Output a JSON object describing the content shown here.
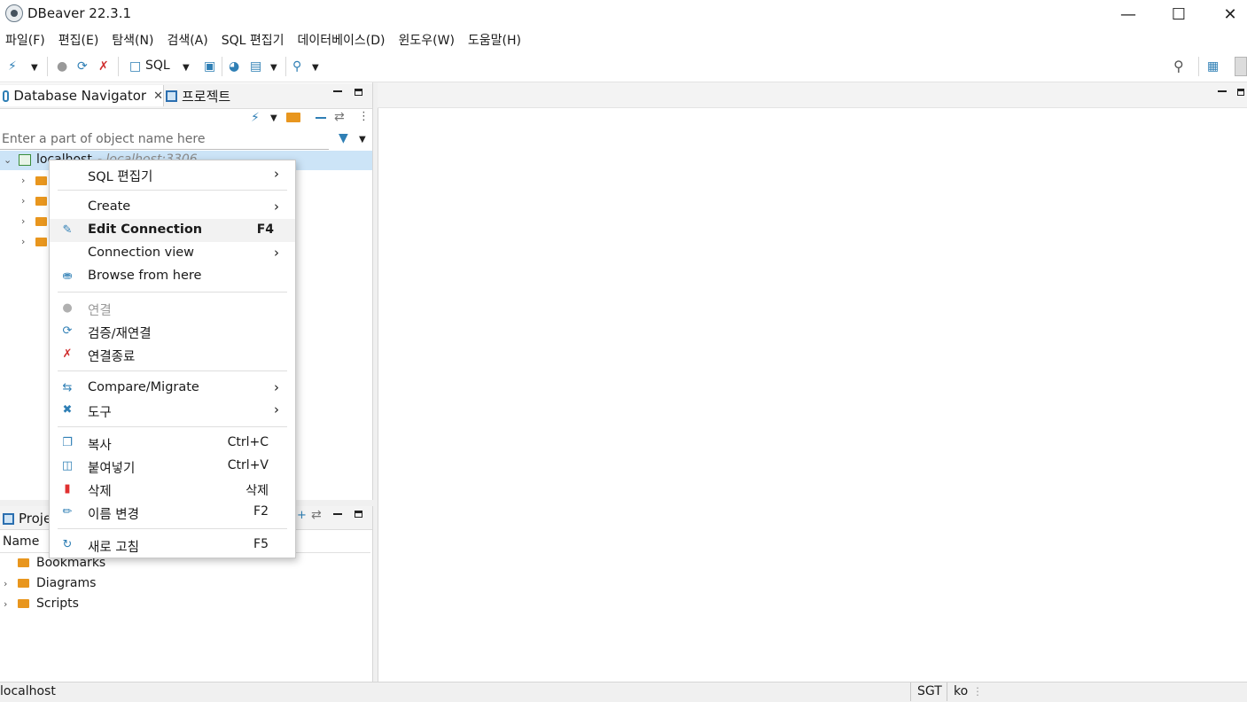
{
  "window": {
    "title": "DBeaver 22.3.1"
  },
  "menubar": [
    "파일(F)",
    "편집(E)",
    "탐색(N)",
    "검색(A)",
    "SQL 편집기",
    "데이터베이스(D)",
    "윈도우(W)",
    "도움말(H)"
  ],
  "toolbar": {
    "sql_label": "SQL"
  },
  "navigator": {
    "tab_label": "Database Navigator",
    "projects_tab_label": "프로젝트",
    "filter_placeholder": "Enter a part of object name here",
    "connection_name": "localhost",
    "connection_detail": "- localhost:3306"
  },
  "context_menu": {
    "items": [
      {
        "label": "SQL 편집기",
        "shortcut": "",
        "icon": "none",
        "submenu": true
      },
      {
        "label": "Create",
        "shortcut": "",
        "icon": "none",
        "submenu": true
      },
      {
        "label": "Edit Connection",
        "shortcut": "F4",
        "icon": "pencil-icon",
        "bold": true
      },
      {
        "label": "Connection view",
        "shortcut": "",
        "icon": "none",
        "submenu": true
      },
      {
        "label": "Browse from here",
        "shortcut": "",
        "icon": "database-icon"
      },
      {
        "label": "연결",
        "shortcut": "",
        "icon": "plug-icon",
        "disabled": true
      },
      {
        "label": "검증/재연결",
        "shortcut": "",
        "icon": "reconnect-icon"
      },
      {
        "label": "연결종료",
        "shortcut": "",
        "icon": "disconnect-icon"
      },
      {
        "label": "Compare/Migrate",
        "shortcut": "",
        "icon": "compare-icon",
        "submenu": true
      },
      {
        "label": "도구",
        "shortcut": "",
        "icon": "tools-icon",
        "submenu": true
      },
      {
        "label": "복사",
        "shortcut": "Ctrl+C",
        "icon": "copy-icon"
      },
      {
        "label": "붙여넣기",
        "shortcut": "Ctrl+V",
        "icon": "paste-icon"
      },
      {
        "label": "삭제",
        "shortcut": "삭제",
        "icon": "delete-icon"
      },
      {
        "label": "이름 변경",
        "shortcut": "F2",
        "icon": "rename-icon"
      },
      {
        "label": "새로 고침",
        "shortcut": "F5",
        "icon": "refresh-icon"
      }
    ]
  },
  "projects": {
    "tab_label": "Proje",
    "column_name": "Name",
    "items": [
      "Bookmarks",
      "Diagrams",
      "Scripts"
    ]
  },
  "statusbar": {
    "left": "localhost",
    "timezone": "SGT",
    "locale": "ko"
  },
  "colors": {
    "accent": "#2f7fb5",
    "folder": "#e8961e",
    "selection": "#cce4f7"
  }
}
